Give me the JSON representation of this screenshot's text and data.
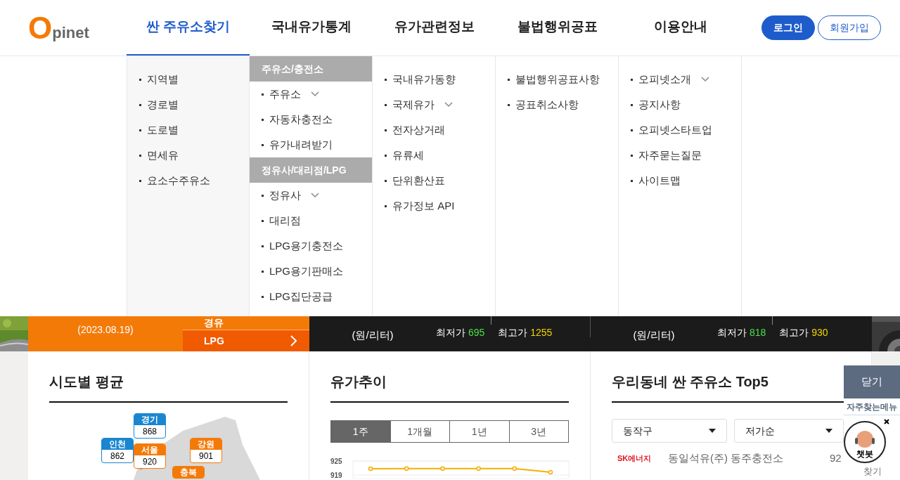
{
  "logo": {
    "mark": "O",
    "text": "pinet"
  },
  "nav": [
    {
      "label": "싼 주유소찾기",
      "selected": true
    },
    {
      "label": "국내유가통계",
      "selected": false
    },
    {
      "label": "유가관련정보",
      "selected": false
    },
    {
      "label": "불법행위공표",
      "selected": false
    },
    {
      "label": "이용안내",
      "selected": false
    }
  ],
  "account_buttons": [
    {
      "label": "로그인",
      "kind": "primary"
    },
    {
      "label": "회원가입",
      "kind": "outline"
    }
  ],
  "menu": {
    "columns": [
      {
        "items": [
          {
            "kind": "link",
            "label": "지역별",
            "expandable": false
          },
          {
            "kind": "link",
            "label": "경로별",
            "expandable": false
          },
          {
            "kind": "link",
            "label": "도로별",
            "expandable": false
          },
          {
            "kind": "link",
            "label": "면세유",
            "expandable": false
          },
          {
            "kind": "link",
            "label": "요소수주유소",
            "expandable": false
          }
        ]
      },
      {
        "items": [
          {
            "kind": "section",
            "label": "주유소/충전소"
          },
          {
            "kind": "link",
            "label": "주유소",
            "expandable": true
          },
          {
            "kind": "link",
            "label": "자동차충전소",
            "expandable": false
          },
          {
            "kind": "link",
            "label": "유가내려받기",
            "expandable": false
          },
          {
            "kind": "section",
            "label": "정유사/대리점/LPG"
          },
          {
            "kind": "link",
            "label": "정유사",
            "expandable": true
          },
          {
            "kind": "link",
            "label": "대리점",
            "expandable": false
          },
          {
            "kind": "link",
            "label": "LPG용기충전소",
            "expandable": false
          },
          {
            "kind": "link",
            "label": "LPG용기판매소",
            "expandable": false
          },
          {
            "kind": "link",
            "label": "LPG집단공급",
            "expandable": false
          }
        ]
      },
      {
        "items": [
          {
            "kind": "link",
            "label": "국내유가동향",
            "expandable": false
          },
          {
            "kind": "link",
            "label": "국제유가",
            "expandable": true
          },
          {
            "kind": "link",
            "label": "전자상거래",
            "expandable": false
          },
          {
            "kind": "link",
            "label": "유류세",
            "expandable": false
          },
          {
            "kind": "link",
            "label": "단위환산표",
            "expandable": false
          },
          {
            "kind": "link",
            "label": "유가정보 API",
            "expandable": false
          }
        ]
      },
      {
        "items": [
          {
            "kind": "link",
            "label": "불법행위공표사항",
            "expandable": false
          },
          {
            "kind": "link",
            "label": "공표취소사항",
            "expandable": false
          }
        ]
      },
      {
        "items": [
          {
            "kind": "link",
            "label": "오피넷소개",
            "expandable": true
          },
          {
            "kind": "link",
            "label": "공지사항",
            "expandable": false
          },
          {
            "kind": "link",
            "label": "오피넷스타트업",
            "expandable": false
          },
          {
            "kind": "link",
            "label": "자주묻는질문",
            "expandable": false
          },
          {
            "kind": "link",
            "label": "사이트맵",
            "expandable": false
          }
        ]
      }
    ]
  },
  "price_band": {
    "date": "(2023.08.19)",
    "fuel_tabs": [
      {
        "label": "경유",
        "selected": false
      },
      {
        "label": "LPG",
        "selected": true
      }
    ],
    "panels": [
      {
        "unit": "(원/리터)",
        "min_label": "최저가",
        "min": "695",
        "max_label": "최고가",
        "max": "1255"
      },
      {
        "unit": "(원/리터)",
        "min_label": "최저가",
        "min": "818",
        "max_label": "최고가",
        "max": "930"
      }
    ]
  },
  "regional_average": {
    "title": "시도별 평균",
    "markers": [
      {
        "region": "경기",
        "value": "868",
        "color": "#1a86d0"
      },
      {
        "region": "인천",
        "value": "862",
        "color": "#1a86d0"
      },
      {
        "region": "서울",
        "value": "920",
        "color": "#f47a08"
      },
      {
        "region": "강원",
        "value": "901",
        "color": "#f47a08"
      },
      {
        "region": "충북",
        "color": "#f47a08"
      }
    ]
  },
  "price_trend": {
    "title": "유가추이",
    "periods": [
      {
        "label": "1주",
        "selected": true
      },
      {
        "label": "1개월",
        "selected": false
      },
      {
        "label": "1년",
        "selected": false
      },
      {
        "label": "3년",
        "selected": false
      }
    ],
    "chart_data": {
      "type": "line",
      "ylim": [
        917.5,
        925
      ],
      "yticks": [
        925,
        919
      ],
      "series": [
        {
          "color": "#f5b000",
          "marker": "circle",
          "values": [
            921.7,
            921.8,
            921.8,
            921.8,
            921.8,
            920.2
          ]
        }
      ]
    }
  },
  "top5": {
    "title": "우리동네 싼 주유소 Top5",
    "district": "동작구",
    "sort": "저가순",
    "rows": [
      {
        "brand": "SK에너지",
        "name": "동일석유(주) 동주충전소",
        "price": "92"
      }
    ]
  },
  "quick_menu": {
    "close": "닫기",
    "title": "자주찾는메뉴",
    "item_visible": [
      "찾기"
    ],
    "chatbot": "챗봇"
  }
}
